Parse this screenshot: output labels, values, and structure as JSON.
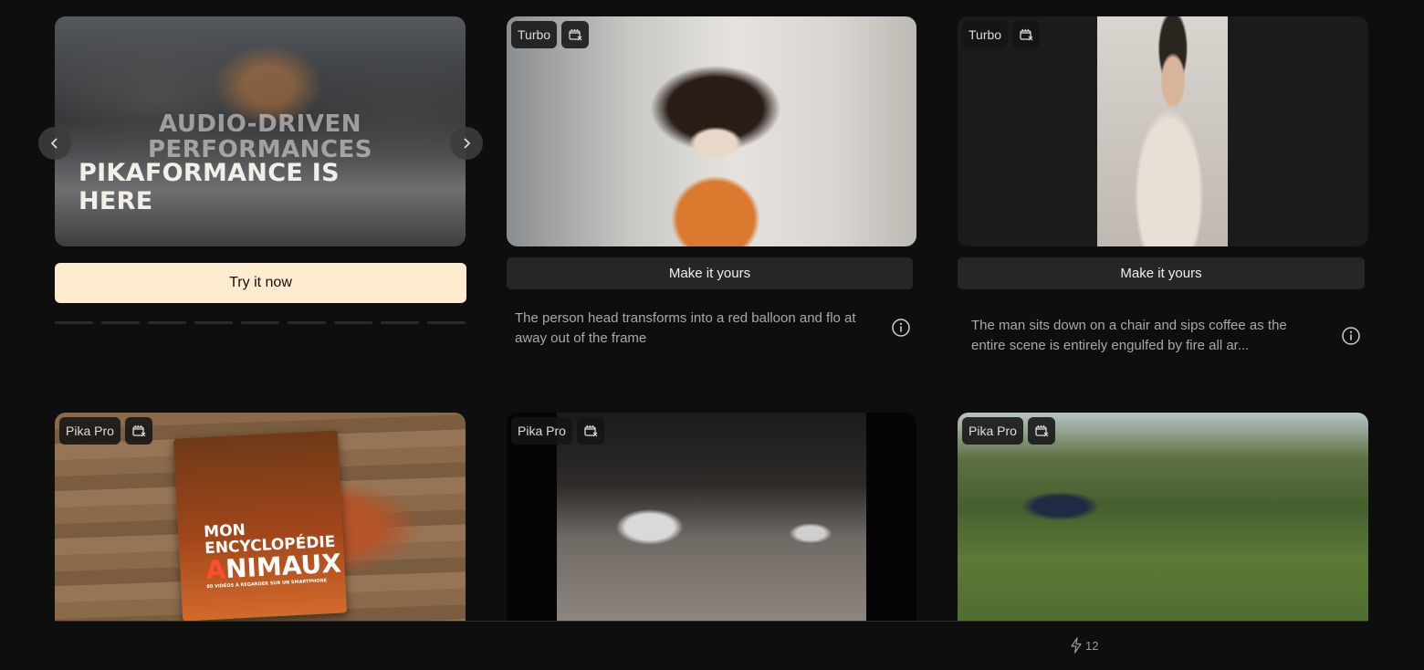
{
  "hero": {
    "subtitle": "AUDIO-DRIVEN PERFORMANCES",
    "title": "PIKAFORMANCE IS HERE",
    "cta_label": "Try it now",
    "slide_count": 9,
    "active_slide": 0
  },
  "cards": [
    {
      "model": "Turbo",
      "action_label": "Make it yours",
      "prompt": "The person head transforms into a red balloon and flo at away out of the frame"
    },
    {
      "model": "Turbo",
      "action_label": "Make it yours",
      "prompt": "The man sits down on a chair and sips coffee as the entire scene is entirely engulfed by fire all ar..."
    },
    {
      "model": "Pika Pro"
    },
    {
      "model": "Pika Pro"
    },
    {
      "model": "Pika Pro"
    }
  ],
  "book_cover": {
    "line1": "MON",
    "line2": "ENCYCLOPÉDIE",
    "line3_accent": "A",
    "line3_rest": "NIMAUX",
    "tagline": "80 VIDÉOS À REGARDER SUR UN SMARTPHONE"
  },
  "credits": {
    "count": "12",
    "icon": "lightning-icon"
  },
  "colors": {
    "background": "#0e0e0e",
    "cta": "#fdebd0",
    "button": "#262626"
  }
}
